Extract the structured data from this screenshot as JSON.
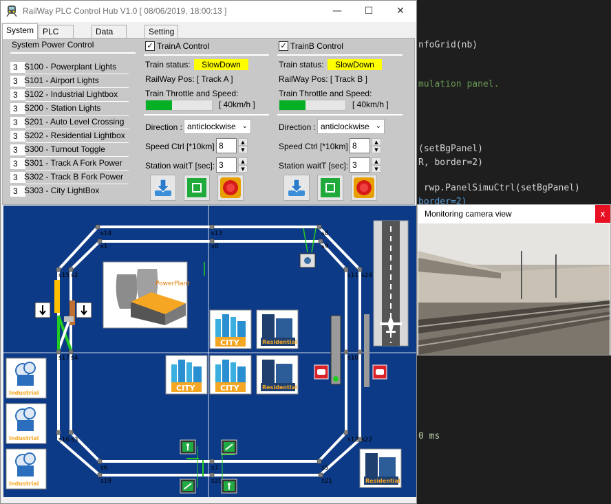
{
  "window": {
    "title": "RailWay PLC Control Hub V1.0 [ 08/06/2019, 18:00:13 ]",
    "minimize_glyph": "—",
    "maximize_glyph": "☐",
    "close_glyph": "✕"
  },
  "tabs": [
    {
      "label": "System",
      "active": true
    },
    {
      "label": "PLC Control",
      "active": false
    },
    {
      "label": "Data Display",
      "active": false
    },
    {
      "label": "Setting",
      "active": false
    }
  ],
  "power": {
    "header": "System Power Control",
    "items": [
      {
        "num": "3",
        "label": "S100 - Powerplant Lights"
      },
      {
        "num": "3",
        "label": "S101 - Airport Lights"
      },
      {
        "num": "3",
        "label": "S102 - Industrial Lightbox"
      },
      {
        "num": "3",
        "label": "S200 - Station Lights"
      },
      {
        "num": "3",
        "label": "S201 - Auto Level Crossing"
      },
      {
        "num": "3",
        "label": "S202 - Residential Lightbox"
      },
      {
        "num": "3",
        "label": "S300 - Turnout Toggle"
      },
      {
        "num": "3",
        "label": "S301 - Track A Fork Power"
      },
      {
        "num": "3",
        "label": "S302 - Track B Fork Power"
      },
      {
        "num": "3",
        "label": "S303 - City LightBox"
      }
    ]
  },
  "trainA": {
    "header": "TrainA Control",
    "status_label": "Train status:",
    "status": "SlowDown",
    "pos": "RailWay Pos: [ Track A ]",
    "throttle_label": "Train Throttle and Speed:",
    "throttle_fraction": 0.4,
    "speed": "[ 40km/h ]",
    "direction_label": "Direction :",
    "direction": "anticlockwise",
    "speed_ctrl_label": "Speed Ctrl [*10km]",
    "speed_ctrl": "8",
    "wait_label": "Station waitT [sec]:",
    "wait": "3"
  },
  "trainB": {
    "header": "TrainB Control",
    "status_label": "Train status:",
    "status": "SlowDown",
    "pos": "RailWay Pos: [ Track B ]",
    "throttle_label": "Train Throttle and Speed:",
    "throttle_fraction": 0.4,
    "speed": "[ 40km/h ]",
    "direction_label": "Direction :",
    "direction": "anticlockwise",
    "speed_ctrl_label": "Speed Ctrl [*10km]",
    "speed_ctrl": "8",
    "wait_label": "Station waitT [sec]:",
    "wait": "3"
  },
  "map": {
    "sensors": [
      "s14",
      "s13",
      "s8",
      "s1",
      "s0",
      "s9",
      "s15",
      "s2",
      "s11",
      "s24",
      "s17",
      "s4",
      "s10",
      "s16",
      "s3",
      "s12",
      "s22",
      "s6",
      "s7",
      "s5",
      "s19",
      "s20",
      "s21"
    ],
    "powerplant_label": "PowerPlant",
    "city_label": "CITY",
    "residential_label": "Residential",
    "industrial_label": "Industrial",
    "colors": {
      "background": "#0d3a86",
      "track": "#ffffff",
      "active_track": "#22cc22"
    }
  },
  "camera": {
    "title": "Monitoring camera view",
    "close_glyph": "x"
  },
  "editor": {
    "lines": [
      {
        "text": "nfoGrid(nb)",
        "cls": ""
      },
      {
        "text": "mulation panel.",
        "cls": "cm"
      },
      {
        "text": "(setBgPanel)",
        "cls": ""
      },
      {
        "text": "R, border=2)",
        "cls": ""
      },
      {
        "text": " rwp.PanelSimuCtrl(setBgPanel)",
        "cls": ""
      },
      {
        "text": "border=2)",
        "cls": ""
      },
      {
        "text": "0 ms",
        "cls": "num"
      }
    ]
  }
}
